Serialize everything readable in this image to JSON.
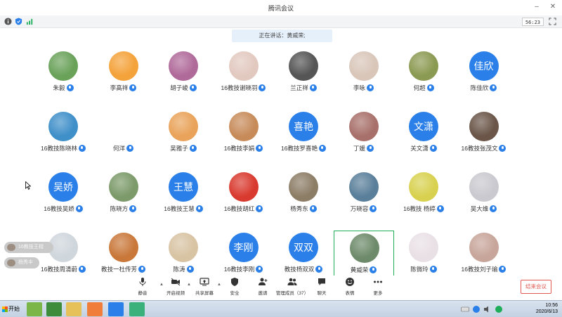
{
  "window": {
    "title": "腾讯会议"
  },
  "status": {
    "timer": "56:23"
  },
  "speaking": {
    "text": "正在讲话：黄威荣;"
  },
  "participants": [
    {
      "name": "朱毅",
      "avatar": "photo",
      "color": "#6aa25a"
    },
    {
      "name": "李高祥",
      "avatar": "photo",
      "color": "#f4a23a"
    },
    {
      "name": "胡子峻",
      "avatar": "photo",
      "color": "#b06a9a"
    },
    {
      "name": "16教技谢晓羽",
      "avatar": "photo",
      "color": "#e2c9c0"
    },
    {
      "name": "兰正祥",
      "avatar": "photo",
      "color": "#555555"
    },
    {
      "name": "李咏",
      "avatar": "photo",
      "color": "#d9c6b9"
    },
    {
      "name": "何超",
      "avatar": "photo",
      "color": "#8b9a52"
    },
    {
      "name": "陈佳欣",
      "avatar": "text",
      "text": "佳欣"
    },
    {
      "name": "16教技陈晓林",
      "avatar": "photo",
      "color": "#3f8fc9"
    },
    {
      "name": "何洋",
      "avatar": "blank"
    },
    {
      "name": "吴雅子",
      "avatar": "photo",
      "color": "#e9a35a"
    },
    {
      "name": "16教技李娟",
      "avatar": "photo",
      "color": "#c78b5a"
    },
    {
      "name": "16教技罗喜艳",
      "avatar": "text",
      "text": "喜艳"
    },
    {
      "name": "丁媛",
      "avatar": "photo",
      "color": "#a8706a"
    },
    {
      "name": "关文潇",
      "avatar": "text",
      "text": "文潇"
    },
    {
      "name": "16教技张茂文",
      "avatar": "photo",
      "color": "#6a5548"
    },
    {
      "name": "16教技吴娇",
      "avatar": "text",
      "text": "吴娇"
    },
    {
      "name": "陈晓方",
      "avatar": "photo",
      "color": "#7c9a6a"
    },
    {
      "name": "16教技王慧",
      "avatar": "text",
      "text": "王慧"
    },
    {
      "name": "16教技胡红",
      "avatar": "photo",
      "color": "#d93a2f"
    },
    {
      "name": "杨秀东",
      "avatar": "photo",
      "color": "#8c7d66"
    },
    {
      "name": "万晓容",
      "avatar": "photo",
      "color": "#5a7f9a"
    },
    {
      "name": "16教技 杨婷",
      "avatar": "photo",
      "color": "#d8d150"
    },
    {
      "name": "吴大维",
      "avatar": "photo",
      "color": "#c9c9cf"
    },
    {
      "name": "16教技周清蔚",
      "avatar": "photo",
      "color": "#cfd6dc"
    },
    {
      "name": "教技一杜传芳",
      "avatar": "photo",
      "color": "#c9783a"
    },
    {
      "name": "陈涛",
      "avatar": "photo",
      "color": "#d8c3a3"
    },
    {
      "name": "16教技李刚",
      "avatar": "text",
      "text": "李刚"
    },
    {
      "name": "教技杨双双",
      "avatar": "text",
      "text": "双双"
    },
    {
      "name": "黄威荣",
      "avatar": "photo",
      "color": "#6d8a6a",
      "active": true
    },
    {
      "name": "陈微玲",
      "avatar": "photo",
      "color": "#e9e0e6"
    },
    {
      "name": "16教技刘子瑜",
      "avatar": "photo",
      "color": "#c7a59a"
    }
  ],
  "floating": [
    {
      "label": "16教技王相源"
    },
    {
      "label": "杨秀丰"
    }
  ],
  "toolbar": {
    "mute": "静音",
    "video": "开启视频",
    "share": "共享屏幕",
    "security": "安全",
    "invite": "邀请",
    "manage": "管理成员（37）",
    "chat": "聊天",
    "emoji": "表情",
    "more": "更多",
    "end": "结束会议"
  },
  "taskbar": {
    "start": "开始",
    "time": "10:56",
    "date": "2020/6/13"
  }
}
